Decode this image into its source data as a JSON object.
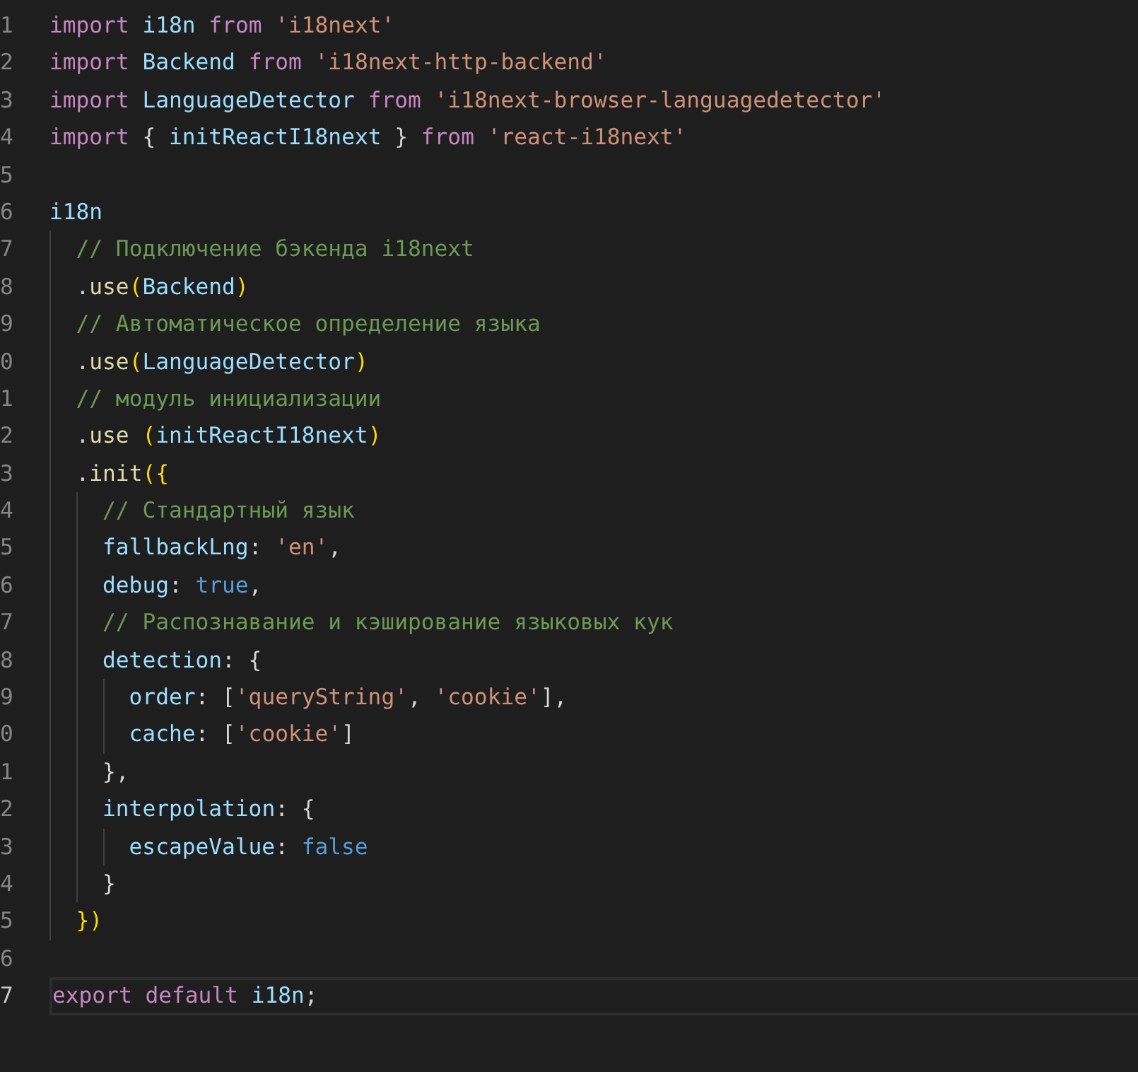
{
  "editor": {
    "lines": [
      {
        "number": "1",
        "current": false,
        "tokens": [
          {
            "kind": "keyword",
            "text": "import "
          },
          {
            "kind": "variable",
            "text": "i18n "
          },
          {
            "kind": "keyword",
            "text": "from "
          },
          {
            "kind": "string",
            "text": "'i18next'"
          }
        ]
      },
      {
        "number": "2",
        "current": false,
        "tokens": [
          {
            "kind": "keyword",
            "text": "import "
          },
          {
            "kind": "variable",
            "text": "Backend "
          },
          {
            "kind": "keyword",
            "text": "from "
          },
          {
            "kind": "string",
            "text": "'i18next-http-backend'"
          }
        ]
      },
      {
        "number": "3",
        "current": false,
        "tokens": [
          {
            "kind": "keyword",
            "text": "import "
          },
          {
            "kind": "variable",
            "text": "LanguageDetector "
          },
          {
            "kind": "keyword",
            "text": "from "
          },
          {
            "kind": "string",
            "text": "'i18next-browser-languagedetector'"
          }
        ]
      },
      {
        "number": "4",
        "current": false,
        "tokens": [
          {
            "kind": "keyword",
            "text": "import"
          },
          {
            "kind": "plain",
            "text": " { "
          },
          {
            "kind": "variable",
            "text": "initReactI18next"
          },
          {
            "kind": "plain",
            "text": " } "
          },
          {
            "kind": "keyword",
            "text": "from "
          },
          {
            "kind": "string",
            "text": "'react-i18next'"
          }
        ]
      },
      {
        "number": "5",
        "current": false
      },
      {
        "number": "6",
        "current": false,
        "tokens": [
          {
            "kind": "variable",
            "text": "i18n"
          }
        ]
      },
      {
        "number": "7",
        "current": false,
        "tokens": [
          {
            "kind": "comment",
            "text": "  // Подключение бэкенда i18next"
          }
        ]
      },
      {
        "number": "8",
        "current": false,
        "tokens": [
          {
            "kind": "plain",
            "text": "  ."
          },
          {
            "kind": "function",
            "text": "use"
          },
          {
            "kind": "bracket",
            "text": "("
          },
          {
            "kind": "variable",
            "text": "Backend"
          },
          {
            "kind": "bracket",
            "text": ")"
          }
        ]
      },
      {
        "number": "9",
        "current": false,
        "tokens": [
          {
            "kind": "comment",
            "text": "  // Автоматическое определение языка"
          }
        ]
      },
      {
        "number": "0",
        "current": false,
        "tokens": [
          {
            "kind": "plain",
            "text": "  ."
          },
          {
            "kind": "function",
            "text": "use"
          },
          {
            "kind": "bracket",
            "text": "("
          },
          {
            "kind": "variable",
            "text": "LanguageDetector"
          },
          {
            "kind": "bracket",
            "text": ")"
          }
        ]
      },
      {
        "number": "1",
        "current": false,
        "tokens": [
          {
            "kind": "comment",
            "text": "  // модуль инициализации"
          }
        ]
      },
      {
        "number": "2",
        "current": false,
        "tokens": [
          {
            "kind": "plain",
            "text": "  ."
          },
          {
            "kind": "function",
            "text": "use "
          },
          {
            "kind": "bracket",
            "text": "("
          },
          {
            "kind": "variable",
            "text": "initReactI18next"
          },
          {
            "kind": "bracket",
            "text": ")"
          }
        ]
      },
      {
        "number": "3",
        "current": false,
        "tokens": [
          {
            "kind": "plain",
            "text": "  ."
          },
          {
            "kind": "function",
            "text": "init"
          },
          {
            "kind": "bracket",
            "text": "({"
          }
        ]
      },
      {
        "number": "4",
        "current": false,
        "tokens": [
          {
            "kind": "comment",
            "text": "    // Стандартный язык"
          }
        ]
      },
      {
        "number": "5",
        "current": false,
        "tokens": [
          {
            "kind": "variable",
            "text": "    fallbackLng"
          },
          {
            "kind": "plain",
            "text": ": "
          },
          {
            "kind": "string",
            "text": "'en'"
          },
          {
            "kind": "plain",
            "text": ","
          }
        ]
      },
      {
        "number": "6",
        "current": false,
        "tokens": [
          {
            "kind": "variable",
            "text": "    debug"
          },
          {
            "kind": "plain",
            "text": ": "
          },
          {
            "kind": "constant",
            "text": "true"
          },
          {
            "kind": "plain",
            "text": ","
          }
        ]
      },
      {
        "number": "7",
        "current": false,
        "tokens": [
          {
            "kind": "comment",
            "text": "    // Распознавание и кэширование языковых кук"
          }
        ]
      },
      {
        "number": "8",
        "current": false,
        "tokens": [
          {
            "kind": "variable",
            "text": "    detection"
          },
          {
            "kind": "plain",
            "text": ": {"
          }
        ]
      },
      {
        "number": "9",
        "current": false,
        "tokens": [
          {
            "kind": "variable",
            "text": "      order"
          },
          {
            "kind": "plain",
            "text": ": ["
          },
          {
            "kind": "string",
            "text": "'queryString'"
          },
          {
            "kind": "plain",
            "text": ", "
          },
          {
            "kind": "string",
            "text": "'cookie'"
          },
          {
            "kind": "plain",
            "text": "],"
          }
        ]
      },
      {
        "number": "0",
        "current": false,
        "tokens": [
          {
            "kind": "variable",
            "text": "      cache"
          },
          {
            "kind": "plain",
            "text": ": ["
          },
          {
            "kind": "string",
            "text": "'cookie'"
          },
          {
            "kind": "plain",
            "text": "]"
          }
        ]
      },
      {
        "number": "1",
        "current": false,
        "tokens": [
          {
            "kind": "plain",
            "text": "    },"
          }
        ]
      },
      {
        "number": "2",
        "current": false,
        "tokens": [
          {
            "kind": "variable",
            "text": "    interpolation"
          },
          {
            "kind": "plain",
            "text": ": {"
          }
        ]
      },
      {
        "number": "3",
        "current": false,
        "tokens": [
          {
            "kind": "variable",
            "text": "      escapeValue"
          },
          {
            "kind": "plain",
            "text": ": "
          },
          {
            "kind": "constant",
            "text": "false"
          }
        ]
      },
      {
        "number": "4",
        "current": false,
        "tokens": [
          {
            "kind": "plain",
            "text": "    }"
          }
        ]
      },
      {
        "number": "5",
        "current": false,
        "tokens": [
          {
            "kind": "bracket",
            "text": "  })"
          }
        ]
      },
      {
        "number": "6",
        "current": false
      },
      {
        "number": "7",
        "current": true,
        "tokens": [
          {
            "kind": "keyword",
            "text": "export "
          },
          {
            "kind": "keyword",
            "text": "default "
          },
          {
            "kind": "variable",
            "text": "i18n"
          },
          {
            "kind": "plain",
            "text": ";"
          }
        ]
      }
    ]
  }
}
